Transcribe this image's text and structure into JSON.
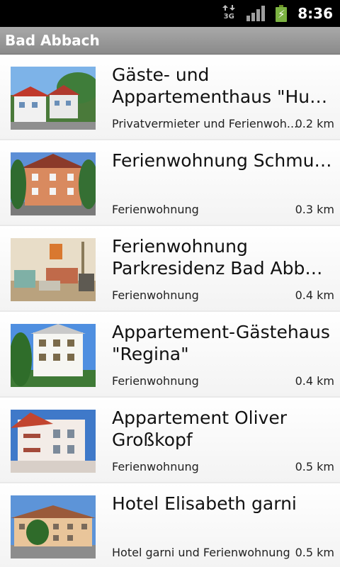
{
  "status": {
    "network_label": "3G",
    "time": "8:36",
    "icons": [
      "network-3g-icon",
      "signal-icon",
      "battery-charging-icon"
    ]
  },
  "titlebar": {
    "title": "Bad Abbach"
  },
  "list": {
    "items": [
      {
        "name_lines": [
          "Gäste- und",
          "Appartementhaus \"Hub..."
        ],
        "type": "Privatvermieter und Ferienwoh...",
        "distance": "0.2 km"
      },
      {
        "name_lines": [
          "Ferienwohnung Schmuck",
          ""
        ],
        "type": "Ferienwohnung",
        "distance": "0.3 km"
      },
      {
        "name_lines": [
          "Ferienwohnung",
          "Parkresidenz Bad Abbac..."
        ],
        "type": "Ferienwohnung",
        "distance": "0.4 km"
      },
      {
        "name_lines": [
          "Appartement-Gästehaus",
          "\"Regina\""
        ],
        "type": "Ferienwohnung",
        "distance": "0.4 km"
      },
      {
        "name_lines": [
          "Appartement Oliver",
          "Großkopf"
        ],
        "type": "Ferienwohnung",
        "distance": "0.5 km"
      },
      {
        "name_lines": [
          "Hotel Elisabeth garni",
          ""
        ],
        "type": "Hotel garni und Ferienwohnung",
        "distance": "0.5 km"
      }
    ]
  }
}
